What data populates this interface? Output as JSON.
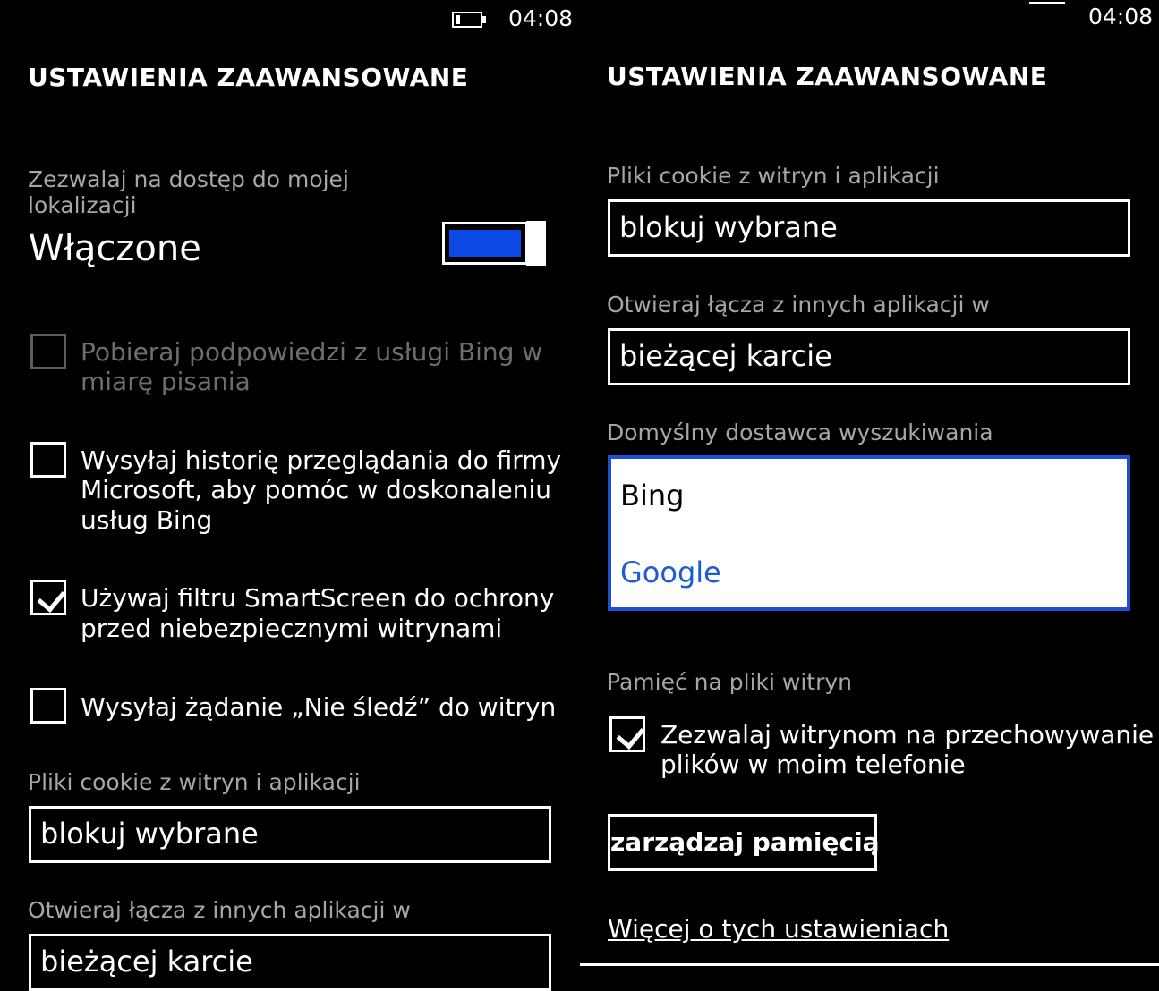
{
  "left": {
    "status": {
      "time": "04:08",
      "battery_icon": "battery-icon"
    },
    "title": "USTAWIENIA ZAAWANSOWANE",
    "location": {
      "label_line1": "Zezwalaj na dostęp do mojej",
      "label_line2": "lokalizacji",
      "value": "Włączone",
      "toggle_on": true,
      "accent": "#0b49e6"
    },
    "bing_suggestions": {
      "line1": "Pobieraj podpowiedzi z usługi Bing w",
      "line2": "miarę pisania",
      "checked": false,
      "enabled": false
    },
    "send_history": {
      "line1": "Wysyłaj historię przeglądania do firmy",
      "line2": "Microsoft, aby pomóc w doskonaleniu",
      "line3": "usług Bing",
      "checked": false
    },
    "smartscreen": {
      "line1": "Używaj filtru SmartScreen do ochrony",
      "line2": "przed niebezpiecznymi witrynami",
      "checked": true
    },
    "do_not_track": {
      "line1": "Wysyłaj żądanie „Nie śledź” do witryn",
      "checked": false
    },
    "cookies": {
      "label": "Pliki cookie z witryn i aplikacji",
      "value": "blokuj wybrane"
    },
    "open_links": {
      "label": "Otwieraj łącza z innych aplikacji w",
      "value": "bieżącej karcie"
    }
  },
  "right": {
    "status": {
      "time": "04:08"
    },
    "title": "USTAWIENIA ZAAWANSOWANE",
    "cookies": {
      "label": "Pliki cookie z witryn i aplikacji",
      "value": "blokuj wybrane"
    },
    "open_links": {
      "label": "Otwieraj łącza z innych aplikacji w",
      "value": "bieżącej karcie"
    },
    "search_provider": {
      "label": "Domyślny dostawca wyszukiwania",
      "options": [
        "Bing",
        "Google"
      ],
      "highlighted": "Google",
      "highlight_color": "#1f5bd1",
      "border_color": "#1d4fd6"
    },
    "storage": {
      "label": "Pamięć na pliki witryn",
      "allow_line1": "Zezwalaj witrynom na przechowywanie",
      "allow_line2": "plików w moim telefonie",
      "checked": true,
      "manage_button": "zarządzaj pamięcią"
    },
    "more_link": "Więcej o tych ustawieniach"
  }
}
